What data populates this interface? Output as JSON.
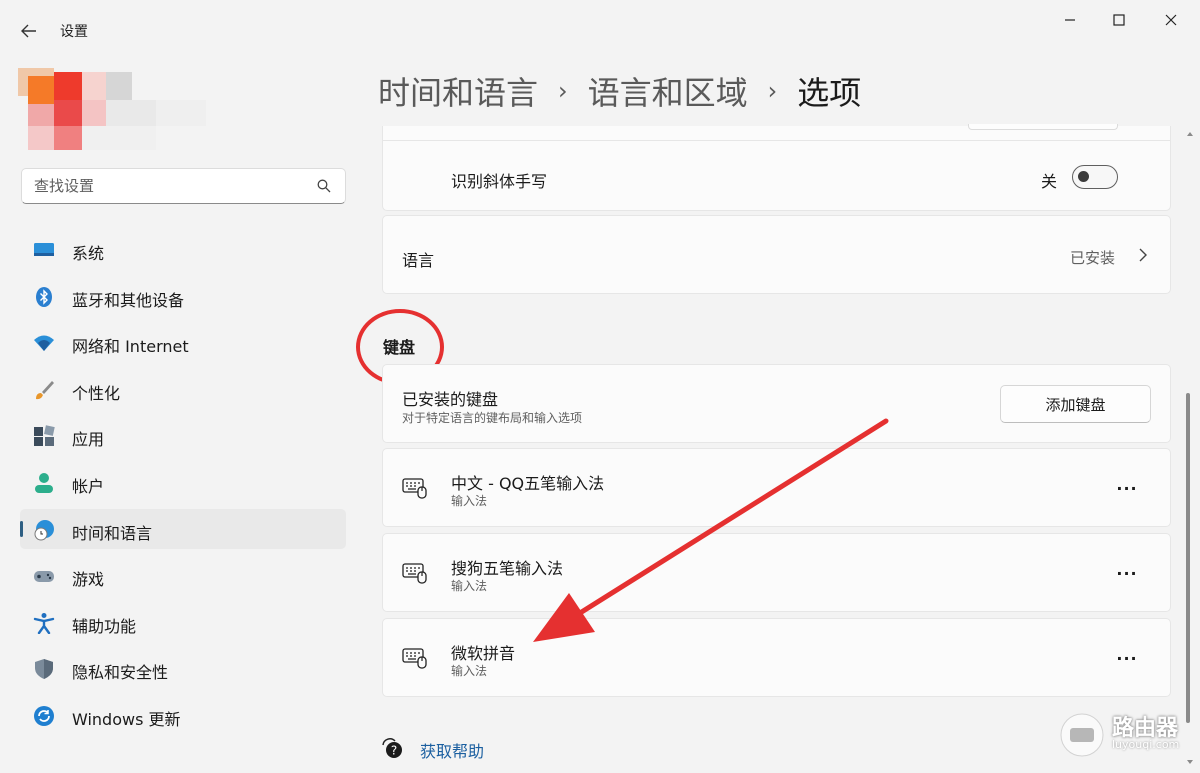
{
  "window": {
    "title": "设置"
  },
  "search": {
    "placeholder": "查找设置"
  },
  "sidebar": {
    "items": [
      {
        "label": "系统",
        "icon": "system-icon"
      },
      {
        "label": "蓝牙和其他设备",
        "icon": "bluetooth-icon"
      },
      {
        "label": "网络和 Internet",
        "icon": "wifi-icon"
      },
      {
        "label": "个性化",
        "icon": "brush-icon"
      },
      {
        "label": "应用",
        "icon": "apps-icon"
      },
      {
        "label": "帐户",
        "icon": "account-icon"
      },
      {
        "label": "时间和语言",
        "icon": "time-language-icon",
        "active": true
      },
      {
        "label": "游戏",
        "icon": "gamepad-icon"
      },
      {
        "label": "辅助功能",
        "icon": "accessibility-icon"
      },
      {
        "label": "隐私和安全性",
        "icon": "shield-icon"
      },
      {
        "label": "Windows 更新",
        "icon": "update-icon"
      }
    ]
  },
  "breadcrumb": {
    "part1": "时间和语言",
    "part2": "语言和区域",
    "current": "选项",
    "separator": "›"
  },
  "handwriting": {
    "label": "识别斜体手写",
    "state_text": "关",
    "on": false
  },
  "language_row": {
    "label": "语言",
    "value": "已安装"
  },
  "keyboard_section": {
    "title": "键盘",
    "installed": {
      "label": "已安装的键盘",
      "sub": "对于特定语言的键布局和输入选项",
      "button": "添加键盘"
    },
    "keyboards": [
      {
        "name": "中文 - QQ五笔输入法",
        "type": "输入法"
      },
      {
        "name": "搜狗五笔输入法",
        "type": "输入法"
      },
      {
        "name": "微软拼音",
        "type": "输入法"
      }
    ],
    "more_label": "···"
  },
  "help": {
    "label": "获取帮助"
  },
  "watermark": {
    "text": "路由器",
    "sub": "luyouqi.com"
  },
  "colors": {
    "accent": "#2d5e82",
    "annotation": "#e53030",
    "link": "#1b5fa0"
  }
}
